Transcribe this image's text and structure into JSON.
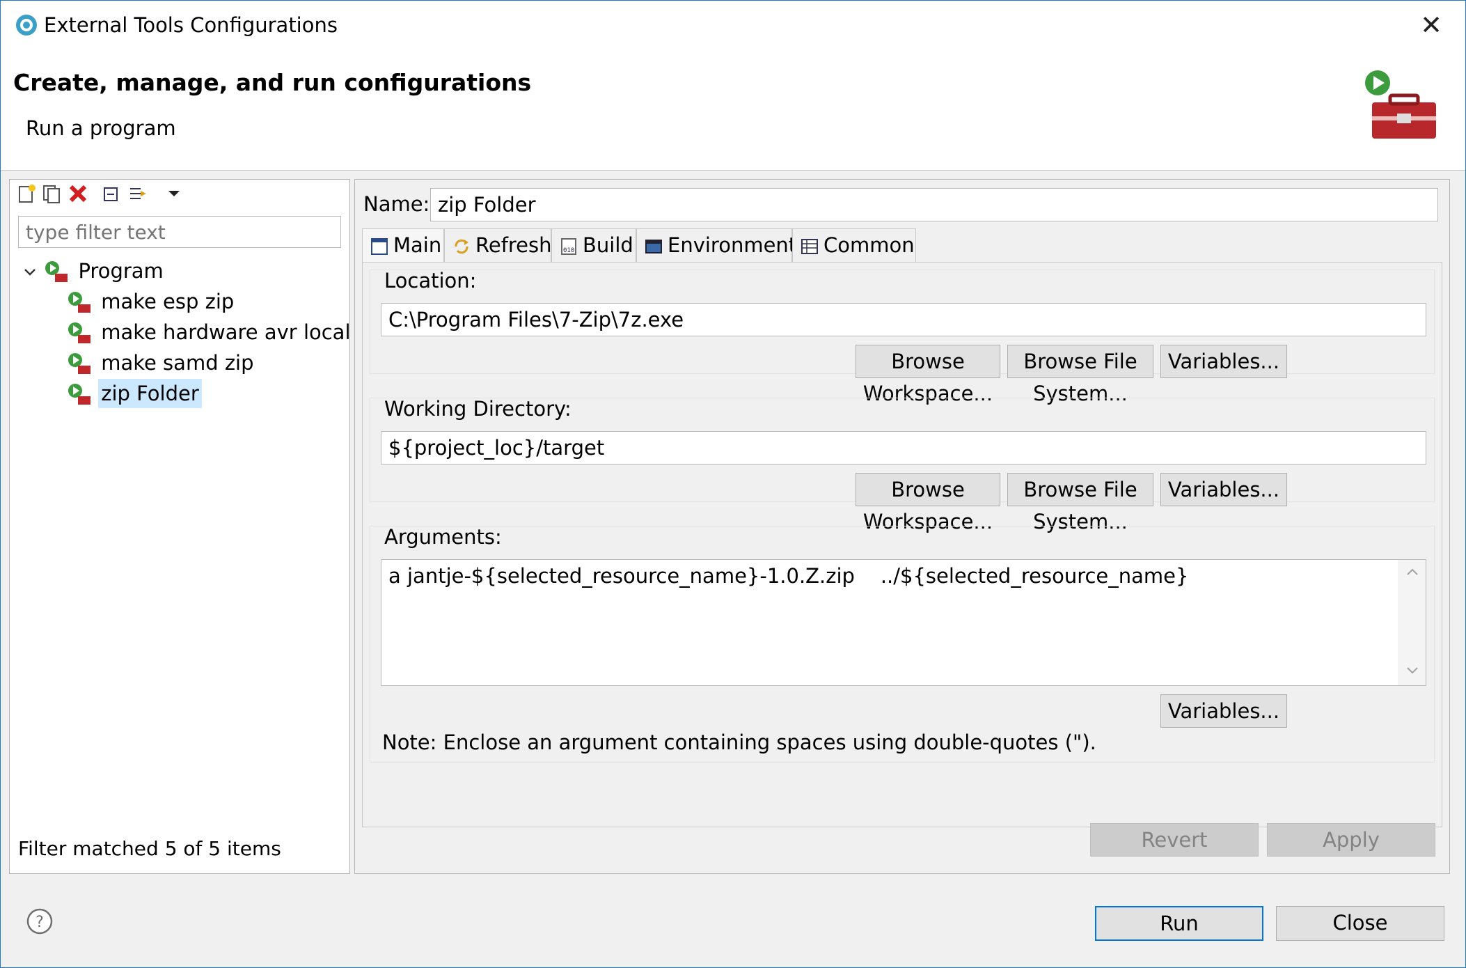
{
  "window": {
    "title": "External Tools Configurations"
  },
  "header": {
    "title": "Create, manage, and run configurations",
    "subtitle": "Run a program"
  },
  "left": {
    "filter_placeholder": "type filter text",
    "tree": {
      "root": "Program",
      "items": [
        "make esp zip",
        "make hardware avr local",
        "make samd zip",
        "zip Folder"
      ],
      "selected": "zip Folder"
    },
    "status": "Filter matched 5 of 5 items"
  },
  "config": {
    "name_label": "Name:",
    "name_value": "zip Folder",
    "tabs": [
      "Main",
      "Refresh",
      "Build",
      "Environment",
      "Common"
    ],
    "active_tab": "Main",
    "location": {
      "label": "Location:",
      "value": "C:\\Program Files\\7-Zip\\7z.exe"
    },
    "working_dir": {
      "label": "Working Directory:",
      "value": "${project_loc}/target"
    },
    "arguments": {
      "label": "Arguments:",
      "value": "a jantje-${selected_resource_name}-1.0.Z.zip    ../${selected_resource_name}"
    },
    "buttons": {
      "browse_workspace": "Browse Workspace...",
      "browse_fs": "Browse File System...",
      "variables": "Variables..."
    },
    "note": "Note: Enclose an argument containing spaces using double-quotes (\").",
    "revert": "Revert",
    "apply": "Apply"
  },
  "footer": {
    "run": "Run",
    "close": "Close"
  },
  "colors": {
    "accent": "#0078d7",
    "selection": "#cce8ff"
  }
}
